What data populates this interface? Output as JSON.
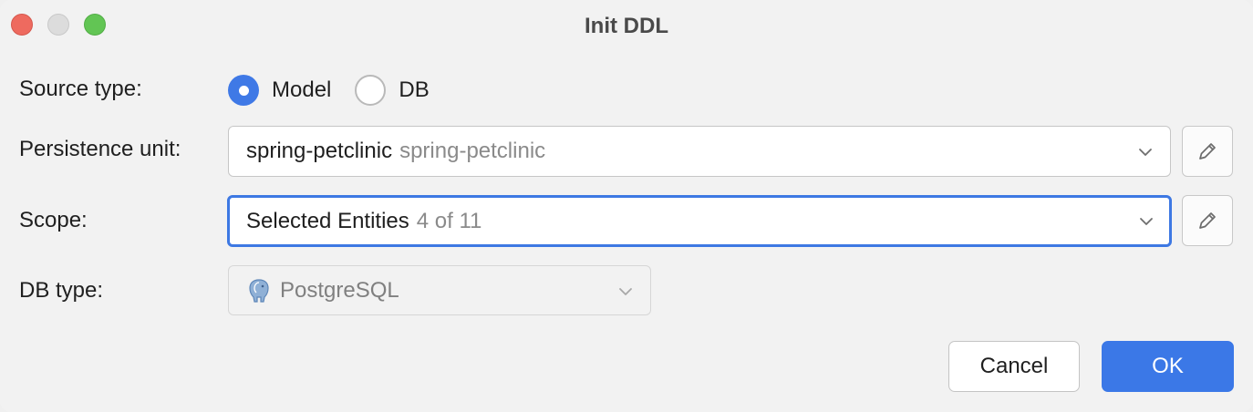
{
  "window": {
    "title": "Init DDL"
  },
  "source_type": {
    "label": "Source type:",
    "options": [
      {
        "label": "Model",
        "selected": true
      },
      {
        "label": "DB",
        "selected": false
      }
    ]
  },
  "persistence_unit": {
    "label": "Persistence unit:",
    "value": "spring-petclinic",
    "hint": "spring-petclinic"
  },
  "scope": {
    "label": "Scope:",
    "value": "Selected Entities",
    "hint": "4 of 11"
  },
  "db_type": {
    "label": "DB type:",
    "value": "PostgreSQL",
    "icon": "postgresql-elephant-icon",
    "enabled": false
  },
  "buttons": {
    "cancel": "Cancel",
    "ok": "OK"
  },
  "colors": {
    "accent": "#3b78e7",
    "close": "#ee6a5f",
    "minimize": "#dcdcdc",
    "zoom": "#62c554",
    "hint_text": "#8a8a8a"
  }
}
